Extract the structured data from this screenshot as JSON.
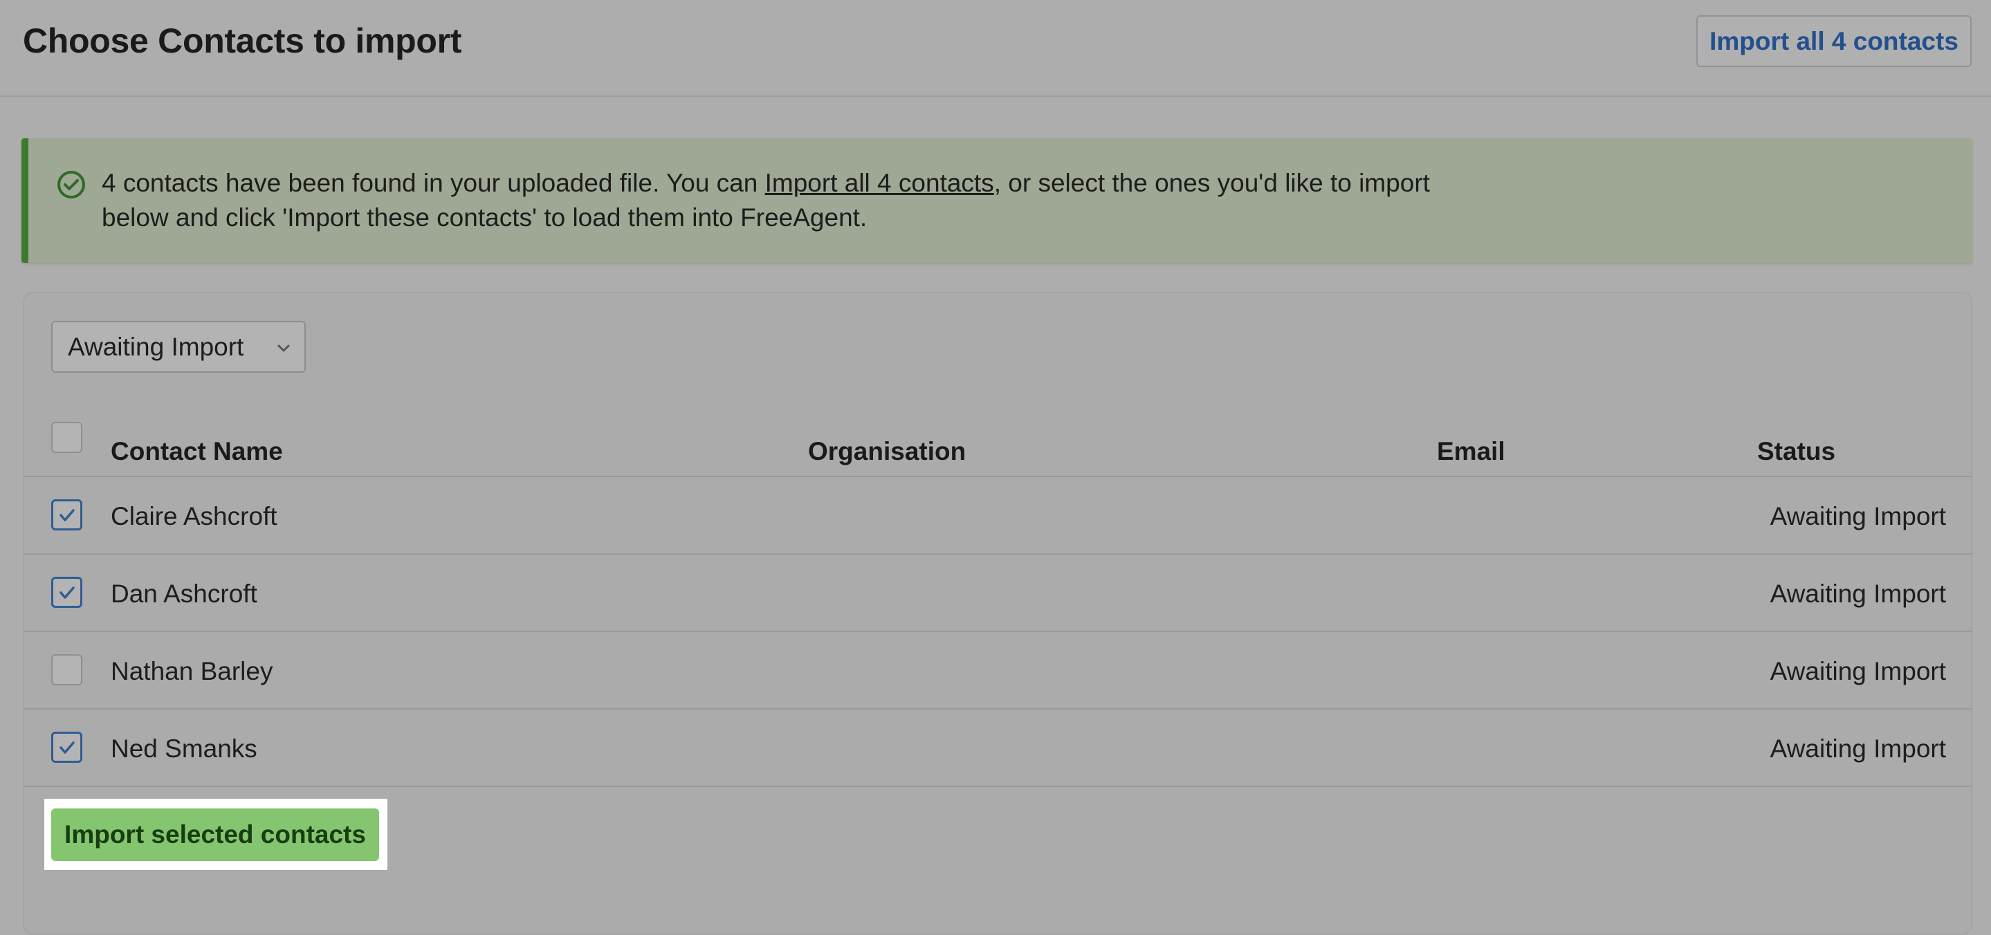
{
  "header": {
    "title": "Choose Contacts to import",
    "import_all_label": "Import all 4 contacts"
  },
  "banner": {
    "text_before": "4 contacts have been found in your uploaded file. You can ",
    "link_text": "Import all 4 contacts",
    "text_after": ", or select the ones you'd like to import below and click 'Import these contacts' to load them into FreeAgent.",
    "icon": "check-circle-icon",
    "accent_color": "#3e7a2e"
  },
  "filter": {
    "selected": "Awaiting Import",
    "icon": "chevron-down-icon"
  },
  "table": {
    "columns": [
      "Contact Name",
      "Organisation",
      "Email",
      "Status"
    ],
    "rows": [
      {
        "name": "Claire Ashcroft",
        "organisation": "",
        "email": "",
        "status": "Awaiting Import",
        "checked": true
      },
      {
        "name": "Dan Ashcroft",
        "organisation": "",
        "email": "",
        "status": "Awaiting Import",
        "checked": true
      },
      {
        "name": "Nathan Barley",
        "organisation": "",
        "email": "",
        "status": "Awaiting Import",
        "checked": false
      },
      {
        "name": "Ned Smanks",
        "organisation": "",
        "email": "",
        "status": "Awaiting Import",
        "checked": true
      }
    ]
  },
  "actions": {
    "import_selected_label": "Import selected contacts",
    "primary_color": "#86c56f",
    "link_color": "#244f8f"
  }
}
